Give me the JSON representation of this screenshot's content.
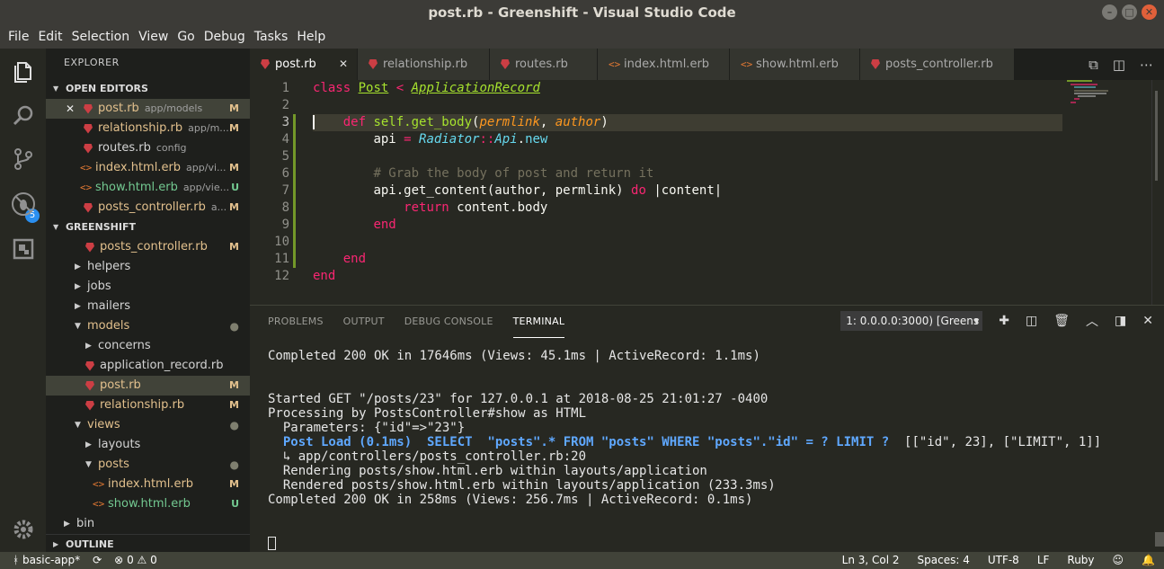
{
  "window": {
    "title": "post.rb - Greenshift - Visual Studio Code"
  },
  "menu": [
    "File",
    "Edit",
    "Selection",
    "View",
    "Go",
    "Debug",
    "Tasks",
    "Help"
  ],
  "activity": {
    "scm_badge": "5"
  },
  "explorer": {
    "title": "EXPLORER",
    "open_editors_label": "OPEN EDITORS",
    "open_editors": [
      {
        "name": "post.rb",
        "path": "app/models",
        "status": "M",
        "type": "ruby"
      },
      {
        "name": "relationship.rb",
        "path": "app/m...",
        "status": "M",
        "type": "ruby"
      },
      {
        "name": "routes.rb",
        "path": "config",
        "status": "",
        "type": "ruby"
      },
      {
        "name": "index.html.erb",
        "path": "app/vi...",
        "status": "M",
        "type": "html"
      },
      {
        "name": "show.html.erb",
        "path": "app/vie...",
        "status": "U",
        "type": "html"
      },
      {
        "name": "posts_controller.rb",
        "path": "a...",
        "status": "M",
        "type": "ruby"
      }
    ],
    "project_label": "GREENSHIFT",
    "tree": {
      "posts_controller": {
        "name": "posts_controller.rb",
        "status": "M"
      },
      "helpers": "helpers",
      "jobs": "jobs",
      "mailers": "mailers",
      "models": "models",
      "concerns": "concerns",
      "application_record": "application_record.rb",
      "post": {
        "name": "post.rb",
        "status": "M"
      },
      "relationship": {
        "name": "relationship.rb",
        "status": "M"
      },
      "views": "views",
      "layouts": "layouts",
      "posts": "posts",
      "index_html": {
        "name": "index.html.erb",
        "status": "M"
      },
      "show_html": {
        "name": "show.html.erb",
        "status": "U"
      },
      "bin": "bin"
    },
    "outline_label": "OUTLINE"
  },
  "tabs": [
    {
      "label": "post.rb",
      "type": "ruby",
      "active": true
    },
    {
      "label": "relationship.rb",
      "type": "ruby"
    },
    {
      "label": "routes.rb",
      "type": "ruby"
    },
    {
      "label": "index.html.erb",
      "type": "html"
    },
    {
      "label": "show.html.erb",
      "type": "html"
    },
    {
      "label": "posts_controller.rb",
      "type": "ruby"
    }
  ],
  "editor": {
    "line_numbers": [
      "1",
      "2",
      "3",
      "4",
      "5",
      "6",
      "7",
      "8",
      "9",
      "10",
      "11",
      "12"
    ],
    "l1": {
      "kw": "class",
      "cls": "Post",
      "op": "<",
      "parent": "ApplicationRecord"
    },
    "l3": {
      "kw": "def",
      "name": "self.get_body",
      "p1": "permlink",
      "p2": "author"
    },
    "l4": {
      "var": "api",
      "op": "=",
      "mod": "Radiator",
      "sep": "::",
      "cls": "Api",
      "dot": ".",
      "meth": "new"
    },
    "l6": {
      "comment": "# Grab the body of post and return it"
    },
    "l7": {
      "call": "api.get_content(author, permlink)",
      "kw": "do",
      "block": "|content|"
    },
    "l8": {
      "kw": "return",
      "expr": "content.body"
    },
    "l9": {
      "kw": "end"
    },
    "l11": {
      "kw": "end"
    },
    "l12": {
      "kw": "end"
    }
  },
  "panel": {
    "tabs": [
      "PROBLEMS",
      "OUTPUT",
      "DEBUG CONSOLE",
      "TERMINAL"
    ],
    "terminal_select": "1: 0.0.0.0:3000) [Greens",
    "lines": {
      "l1": "Completed 200 OK in 17646ms (Views: 45.1ms | ActiveRecord: 1.1ms)",
      "l2": "Started GET \"/posts/23\" for 127.0.0.1 at 2018-08-25 21:01:27 -0400",
      "l3": "Processing by PostsController#show as HTML",
      "l4": "  Parameters: {\"id\"=>\"23\"}",
      "l5_hi": "  Post Load (0.1ms)  SELECT  \"posts\".* FROM \"posts\" WHERE \"posts\".\"id\" = ? LIMIT ?",
      "l5_rest": "  [[\"id\", 23], [\"LIMIT\", 1]]",
      "l6": "  ↳ app/controllers/posts_controller.rb:20",
      "l7": "  Rendering posts/show.html.erb within layouts/application",
      "l8": "  Rendered posts/show.html.erb within layouts/application (233.3ms)",
      "l9": "Completed 200 OK in 258ms (Views: 256.7ms | ActiveRecord: 0.1ms)"
    }
  },
  "status": {
    "branch": "basic-app*",
    "errors": "0",
    "warnings": "0",
    "position": "Ln 3, Col 2",
    "spaces": "Spaces: 4",
    "encoding": "UTF-8",
    "eol": "LF",
    "language": "Ruby"
  }
}
